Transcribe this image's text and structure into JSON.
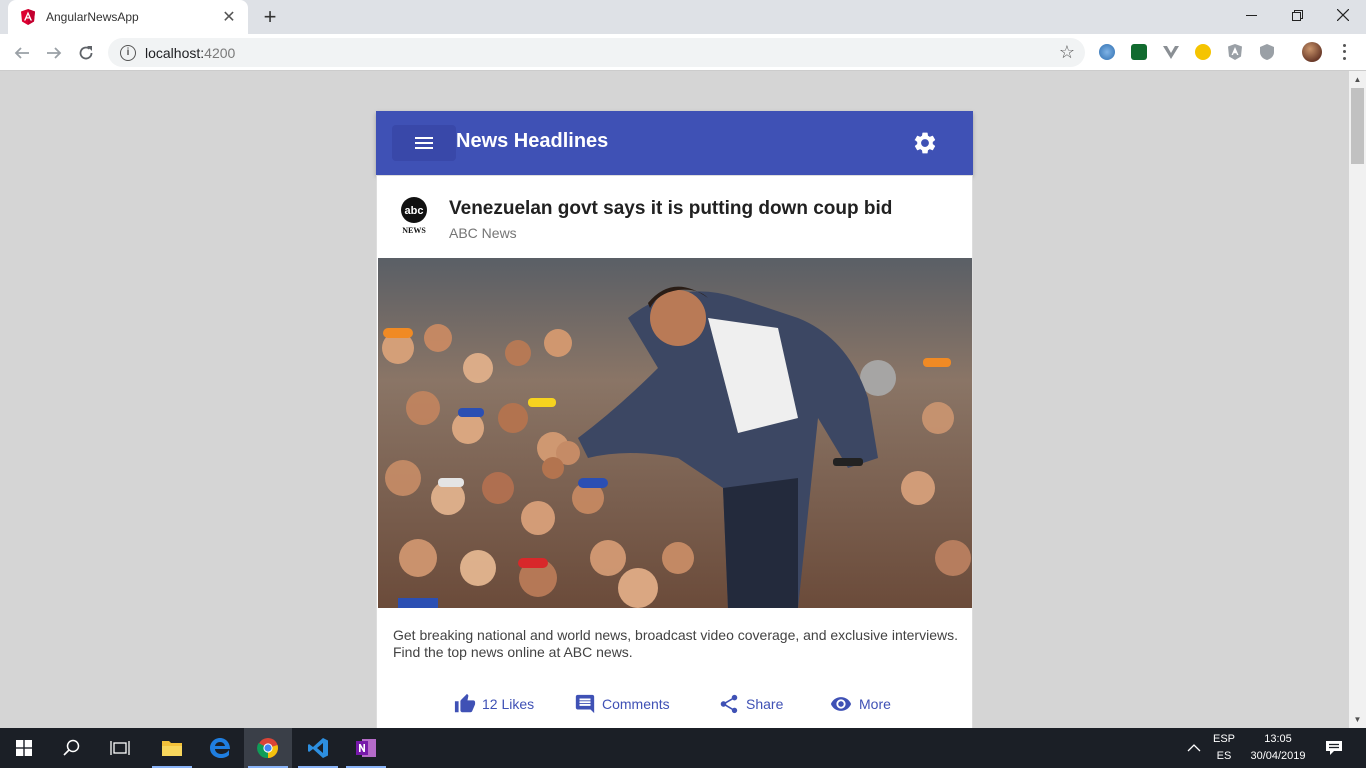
{
  "browser": {
    "tab_title": "AngularNewsApp",
    "url_host": "localhost:",
    "url_port": "4200"
  },
  "app": {
    "title": "News Headlines"
  },
  "article": {
    "headline": "Venezuelan govt says it is putting down coup bid",
    "source": "ABC News",
    "description": "Get breaking national and world news, broadcast video coverage, and exclusive interviews. Find the top news online at ABC news.",
    "actions": {
      "likes": "12 Likes",
      "comments": "Comments",
      "share": "Share",
      "more": "More"
    },
    "logo_text": "abc",
    "logo_subtext": "NEWS"
  },
  "taskbar": {
    "lang_top": "ESP",
    "lang_bottom": "ES",
    "time": "13:05",
    "date": "30/04/2019"
  },
  "colors": {
    "primary": "#3f51b5",
    "page_bg": "#d5d5d5"
  }
}
